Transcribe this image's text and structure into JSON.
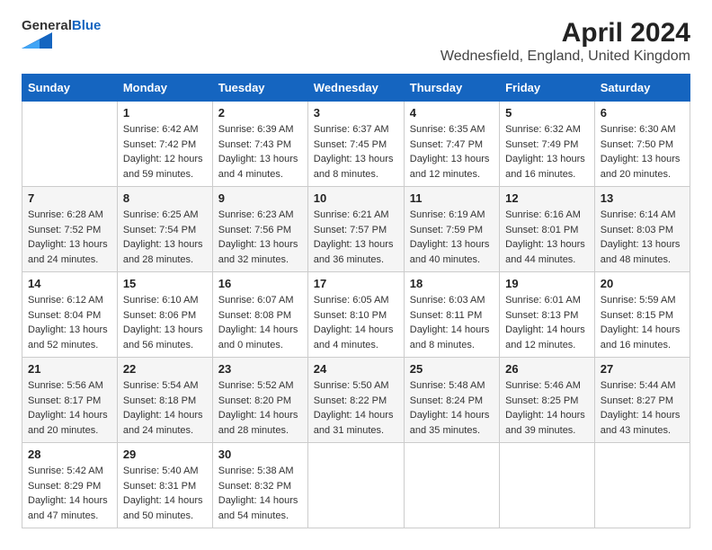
{
  "header": {
    "logo_line1": "General",
    "logo_line2": "Blue",
    "title": "April 2024",
    "subtitle": "Wednesfield, England, United Kingdom"
  },
  "days_of_week": [
    "Sunday",
    "Monday",
    "Tuesday",
    "Wednesday",
    "Thursday",
    "Friday",
    "Saturday"
  ],
  "weeks": [
    [
      {
        "day": "",
        "info": ""
      },
      {
        "day": "1",
        "info": "Sunrise: 6:42 AM\nSunset: 7:42 PM\nDaylight: 12 hours\nand 59 minutes."
      },
      {
        "day": "2",
        "info": "Sunrise: 6:39 AM\nSunset: 7:43 PM\nDaylight: 13 hours\nand 4 minutes."
      },
      {
        "day": "3",
        "info": "Sunrise: 6:37 AM\nSunset: 7:45 PM\nDaylight: 13 hours\nand 8 minutes."
      },
      {
        "day": "4",
        "info": "Sunrise: 6:35 AM\nSunset: 7:47 PM\nDaylight: 13 hours\nand 12 minutes."
      },
      {
        "day": "5",
        "info": "Sunrise: 6:32 AM\nSunset: 7:49 PM\nDaylight: 13 hours\nand 16 minutes."
      },
      {
        "day": "6",
        "info": "Sunrise: 6:30 AM\nSunset: 7:50 PM\nDaylight: 13 hours\nand 20 minutes."
      }
    ],
    [
      {
        "day": "7",
        "info": "Sunrise: 6:28 AM\nSunset: 7:52 PM\nDaylight: 13 hours\nand 24 minutes."
      },
      {
        "day": "8",
        "info": "Sunrise: 6:25 AM\nSunset: 7:54 PM\nDaylight: 13 hours\nand 28 minutes."
      },
      {
        "day": "9",
        "info": "Sunrise: 6:23 AM\nSunset: 7:56 PM\nDaylight: 13 hours\nand 32 minutes."
      },
      {
        "day": "10",
        "info": "Sunrise: 6:21 AM\nSunset: 7:57 PM\nDaylight: 13 hours\nand 36 minutes."
      },
      {
        "day": "11",
        "info": "Sunrise: 6:19 AM\nSunset: 7:59 PM\nDaylight: 13 hours\nand 40 minutes."
      },
      {
        "day": "12",
        "info": "Sunrise: 6:16 AM\nSunset: 8:01 PM\nDaylight: 13 hours\nand 44 minutes."
      },
      {
        "day": "13",
        "info": "Sunrise: 6:14 AM\nSunset: 8:03 PM\nDaylight: 13 hours\nand 48 minutes."
      }
    ],
    [
      {
        "day": "14",
        "info": "Sunrise: 6:12 AM\nSunset: 8:04 PM\nDaylight: 13 hours\nand 52 minutes."
      },
      {
        "day": "15",
        "info": "Sunrise: 6:10 AM\nSunset: 8:06 PM\nDaylight: 13 hours\nand 56 minutes."
      },
      {
        "day": "16",
        "info": "Sunrise: 6:07 AM\nSunset: 8:08 PM\nDaylight: 14 hours\nand 0 minutes."
      },
      {
        "day": "17",
        "info": "Sunrise: 6:05 AM\nSunset: 8:10 PM\nDaylight: 14 hours\nand 4 minutes."
      },
      {
        "day": "18",
        "info": "Sunrise: 6:03 AM\nSunset: 8:11 PM\nDaylight: 14 hours\nand 8 minutes."
      },
      {
        "day": "19",
        "info": "Sunrise: 6:01 AM\nSunset: 8:13 PM\nDaylight: 14 hours\nand 12 minutes."
      },
      {
        "day": "20",
        "info": "Sunrise: 5:59 AM\nSunset: 8:15 PM\nDaylight: 14 hours\nand 16 minutes."
      }
    ],
    [
      {
        "day": "21",
        "info": "Sunrise: 5:56 AM\nSunset: 8:17 PM\nDaylight: 14 hours\nand 20 minutes."
      },
      {
        "day": "22",
        "info": "Sunrise: 5:54 AM\nSunset: 8:18 PM\nDaylight: 14 hours\nand 24 minutes."
      },
      {
        "day": "23",
        "info": "Sunrise: 5:52 AM\nSunset: 8:20 PM\nDaylight: 14 hours\nand 28 minutes."
      },
      {
        "day": "24",
        "info": "Sunrise: 5:50 AM\nSunset: 8:22 PM\nDaylight: 14 hours\nand 31 minutes."
      },
      {
        "day": "25",
        "info": "Sunrise: 5:48 AM\nSunset: 8:24 PM\nDaylight: 14 hours\nand 35 minutes."
      },
      {
        "day": "26",
        "info": "Sunrise: 5:46 AM\nSunset: 8:25 PM\nDaylight: 14 hours\nand 39 minutes."
      },
      {
        "day": "27",
        "info": "Sunrise: 5:44 AM\nSunset: 8:27 PM\nDaylight: 14 hours\nand 43 minutes."
      }
    ],
    [
      {
        "day": "28",
        "info": "Sunrise: 5:42 AM\nSunset: 8:29 PM\nDaylight: 14 hours\nand 47 minutes."
      },
      {
        "day": "29",
        "info": "Sunrise: 5:40 AM\nSunset: 8:31 PM\nDaylight: 14 hours\nand 50 minutes."
      },
      {
        "day": "30",
        "info": "Sunrise: 5:38 AM\nSunset: 8:32 PM\nDaylight: 14 hours\nand 54 minutes."
      },
      {
        "day": "",
        "info": ""
      },
      {
        "day": "",
        "info": ""
      },
      {
        "day": "",
        "info": ""
      },
      {
        "day": "",
        "info": ""
      }
    ]
  ]
}
